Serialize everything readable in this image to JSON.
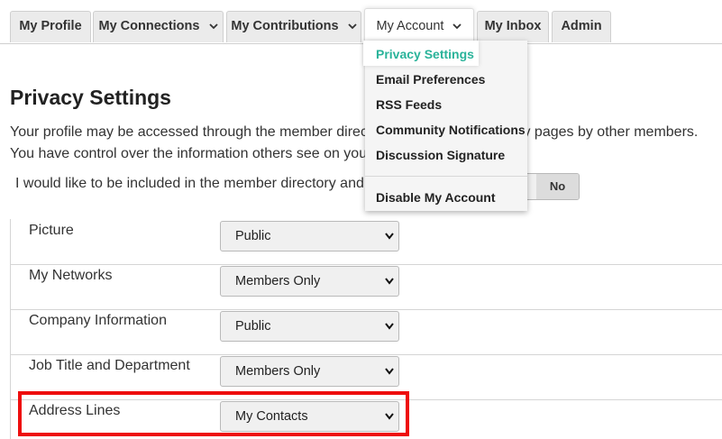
{
  "tabs": [
    {
      "label": "My Profile"
    },
    {
      "label": "My Connections"
    },
    {
      "label": "My Contributions"
    },
    {
      "label": "My Account"
    },
    {
      "label": "My Inbox"
    },
    {
      "label": "Admin"
    }
  ],
  "dropdown": {
    "items": [
      {
        "label": "Privacy Settings"
      },
      {
        "label": "Email Preferences"
      },
      {
        "label": "RSS Feeds"
      },
      {
        "label": "Community Notifications"
      },
      {
        "label": "Discussion Signature"
      },
      {
        "label": "Disable My Account"
      }
    ]
  },
  "page": {
    "title": "Privacy Settings",
    "description": "Your profile may be accessed through the member directory and other community pages by other members. You have control over the information others see on your profile.",
    "directory_question": "I would like to be included in the member directory and searchable by other members.",
    "toggle_no": "No"
  },
  "fields": [
    {
      "label": "Picture",
      "value": "Public"
    },
    {
      "label": "My Networks",
      "value": "Members Only"
    },
    {
      "label": "Company Information",
      "value": "Public"
    },
    {
      "label": "Job Title and Department",
      "value": "Members Only"
    },
    {
      "label": "Address Lines",
      "value": "My Contacts"
    }
  ],
  "colors": {
    "active_menu": "#2ab39a",
    "highlight": "#ee0d0d"
  }
}
